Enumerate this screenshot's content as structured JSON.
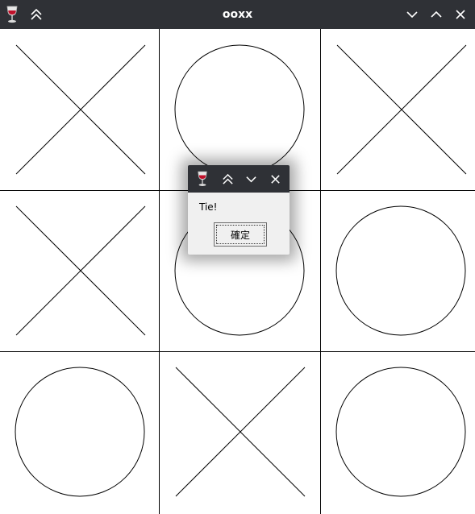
{
  "window": {
    "title": "ooxx",
    "icon": "wine-glass-icon",
    "buttons": [
      "collapse-up-icon",
      "minimize-icon",
      "maximize-icon",
      "close-icon"
    ]
  },
  "board": {
    "cells": [
      [
        "X",
        "O",
        "X"
      ],
      [
        "X",
        "O",
        "O"
      ],
      [
        "O",
        "X",
        "O"
      ]
    ]
  },
  "dialog": {
    "message": "Tie!",
    "ok_label": "確定",
    "buttons": [
      "collapse-up-icon",
      "minimize-icon",
      "close-icon"
    ]
  },
  "colors": {
    "titlebar": "#2f3136",
    "background": "#ffffff",
    "stroke": "#000000",
    "dialog_bg": "#f0f0f0"
  }
}
